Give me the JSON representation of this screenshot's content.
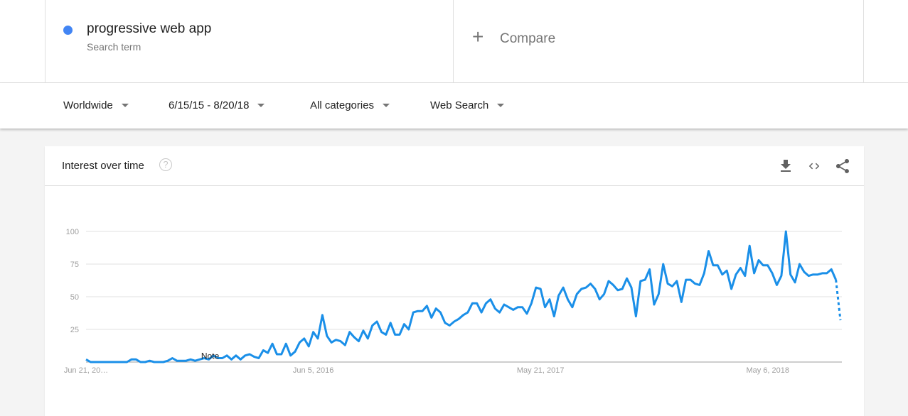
{
  "search_term": {
    "name": "progressive web app",
    "subtitle": "Search term",
    "color": "#4285f4"
  },
  "compare": {
    "label": "Compare",
    "icon": "plus-icon"
  },
  "filters": [
    {
      "label": "Worldwide"
    },
    {
      "label": "6/15/15 - 8/20/18"
    },
    {
      "label": "All categories"
    },
    {
      "label": "Web Search"
    }
  ],
  "panel": {
    "title": "Interest over time",
    "help_icon": "?",
    "actions": [
      "download-icon",
      "embed-code-icon",
      "share-icon"
    ]
  },
  "chart_data": {
    "type": "line",
    "title": "Interest over time",
    "xlabel": "",
    "ylabel": "",
    "ylim": [
      0,
      100
    ],
    "yticks": [
      "100",
      "75",
      "50",
      "25"
    ],
    "xtick_labels": [
      {
        "index": 0,
        "label": "Jun 21, 20…"
      },
      {
        "index": 50,
        "label": "Jun 5, 2016"
      },
      {
        "index": 100,
        "label": "May 21, 2017"
      },
      {
        "index": 150,
        "label": "May 6, 2018"
      }
    ],
    "annotation": {
      "index": 27,
      "label": "Note"
    },
    "grid": true,
    "legend": "none",
    "line_color": "#1a8fe8",
    "partial_last_point": true,
    "series": [
      {
        "name": "progressive web app",
        "values": [
          2,
          0,
          0,
          0,
          0,
          0,
          0,
          0,
          0,
          0,
          2,
          2,
          0,
          0,
          1,
          0,
          0,
          0,
          1,
          3,
          1,
          1,
          1,
          2,
          1,
          2,
          3,
          2,
          5,
          3,
          3,
          5,
          2,
          5,
          2,
          5,
          6,
          4,
          3,
          9,
          7,
          14,
          6,
          6,
          14,
          5,
          8,
          15,
          18,
          12,
          23,
          18,
          36,
          20,
          15,
          17,
          16,
          13,
          23,
          19,
          16,
          24,
          18,
          28,
          31,
          23,
          21,
          30,
          21,
          21,
          29,
          25,
          38,
          39,
          39,
          43,
          34,
          41,
          38,
          30,
          28,
          31,
          33,
          36,
          38,
          45,
          45,
          38,
          45,
          48,
          41,
          38,
          44,
          42,
          40,
          42,
          42,
          37,
          45,
          57,
          56,
          42,
          48,
          35,
          51,
          57,
          48,
          42,
          52,
          56,
          57,
          60,
          56,
          48,
          52,
          62,
          59,
          55,
          56,
          64,
          57,
          35,
          62,
          63,
          71,
          44,
          52,
          75,
          60,
          58,
          62,
          46,
          63,
          63,
          60,
          59,
          68,
          85,
          74,
          74,
          67,
          70,
          56,
          67,
          72,
          66,
          89,
          68,
          78,
          74,
          74,
          68,
          59,
          66,
          100,
          67,
          61,
          75,
          69,
          66,
          67,
          67,
          68,
          68,
          71,
          63,
          32
        ]
      }
    ]
  }
}
